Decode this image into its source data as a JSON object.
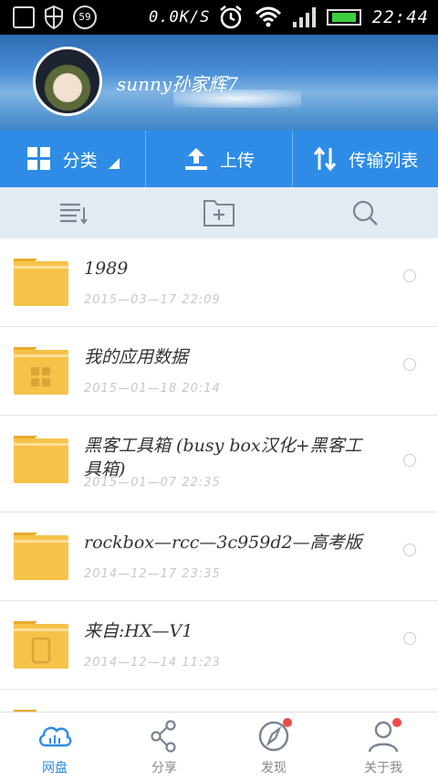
{
  "status_bar": {
    "battery_badge": "59",
    "net_speed": "0.0K/S",
    "time": "22:44"
  },
  "profile": {
    "username": "sunny孙家辉7"
  },
  "actions": [
    {
      "label": "分类",
      "icon": "grid-icon"
    },
    {
      "label": "上传",
      "icon": "upload-icon"
    },
    {
      "label": "传输列表",
      "icon": "transfer-icon"
    }
  ],
  "toolbar": [
    {
      "icon": "sort-list-icon"
    },
    {
      "icon": "new-folder-icon"
    },
    {
      "icon": "search-icon"
    }
  ],
  "files": [
    {
      "name": "1989",
      "date": "2015—03—17  22:09",
      "icon": "folder-icon"
    },
    {
      "name": "我的应用数据",
      "date": "2015—01—18  20:14",
      "icon": "folder-apps-icon"
    },
    {
      "name": "黑客工具箱 (busy box汉化+黑客工具箱)",
      "date": "2015—01—07  22:35",
      "icon": "folder-icon"
    },
    {
      "name": "rockbox—rcc—3c959d2—高考版",
      "date": "2014—12—17  23:35",
      "icon": "folder-icon"
    },
    {
      "name": "来自:HX—V1",
      "date": "2014—12—14  11:23",
      "icon": "folder-device-icon"
    }
  ],
  "nav": [
    {
      "label": "网盘",
      "icon": "cloud-icon",
      "active": true
    },
    {
      "label": "分享",
      "icon": "share-icon",
      "active": false
    },
    {
      "label": "发现",
      "icon": "compass-icon",
      "active": false,
      "badge": true
    },
    {
      "label": "关于我",
      "icon": "user-icon",
      "active": false,
      "badge": true
    }
  ],
  "colors": {
    "primary": "#2e8ce6",
    "folder": "#f5c24a",
    "badge": "#f04a4a"
  }
}
